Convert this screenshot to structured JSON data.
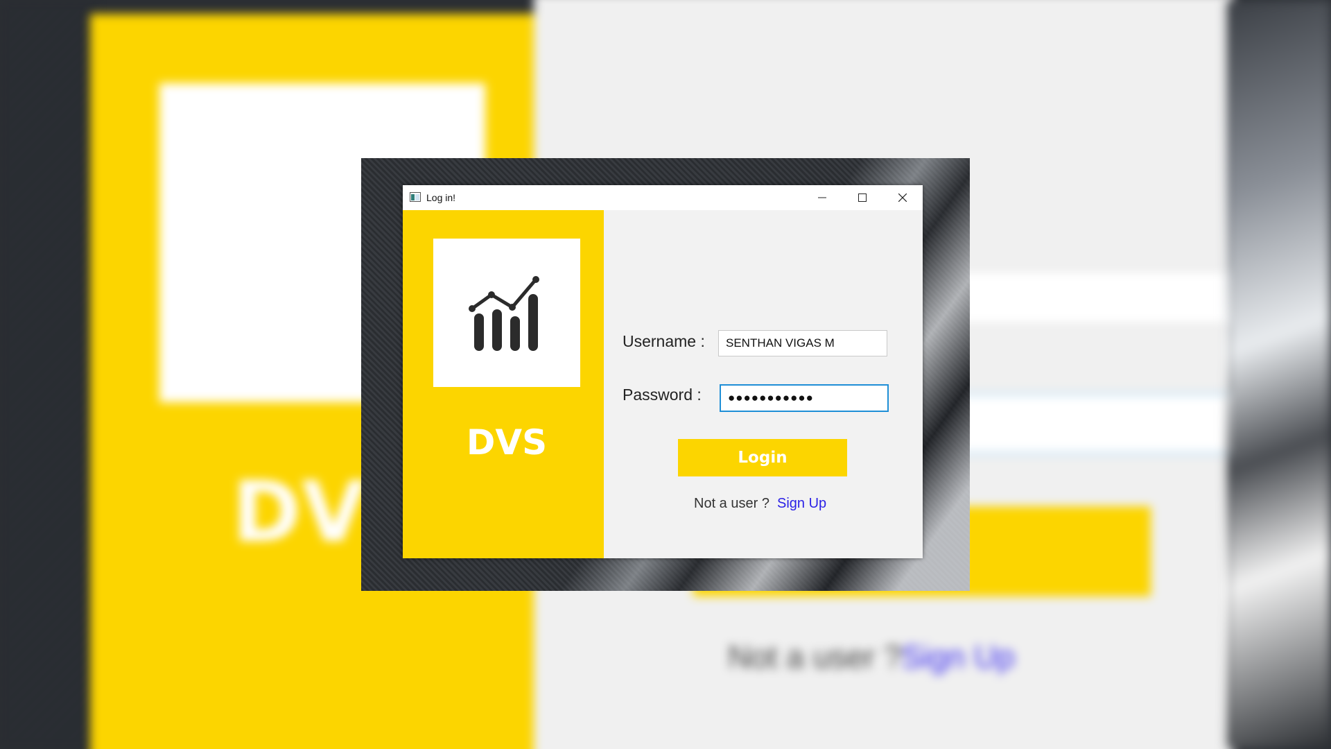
{
  "window": {
    "title": "Log in!"
  },
  "sidebar": {
    "brand": "DVS",
    "logo_icon": "chart-trend-icon",
    "color": "#fcd500"
  },
  "form": {
    "username_label": "Username :",
    "username_value": "SENTHAN VIGAS M",
    "password_label": "Password  :",
    "password_value": "●●●●●●●●●●●",
    "login_label": "Login",
    "not_user_text": "Not a user ?",
    "signup_label": "Sign Up"
  },
  "colors": {
    "accent": "#fcd500",
    "link": "#2b21e6",
    "focus": "#1e8ed6"
  }
}
